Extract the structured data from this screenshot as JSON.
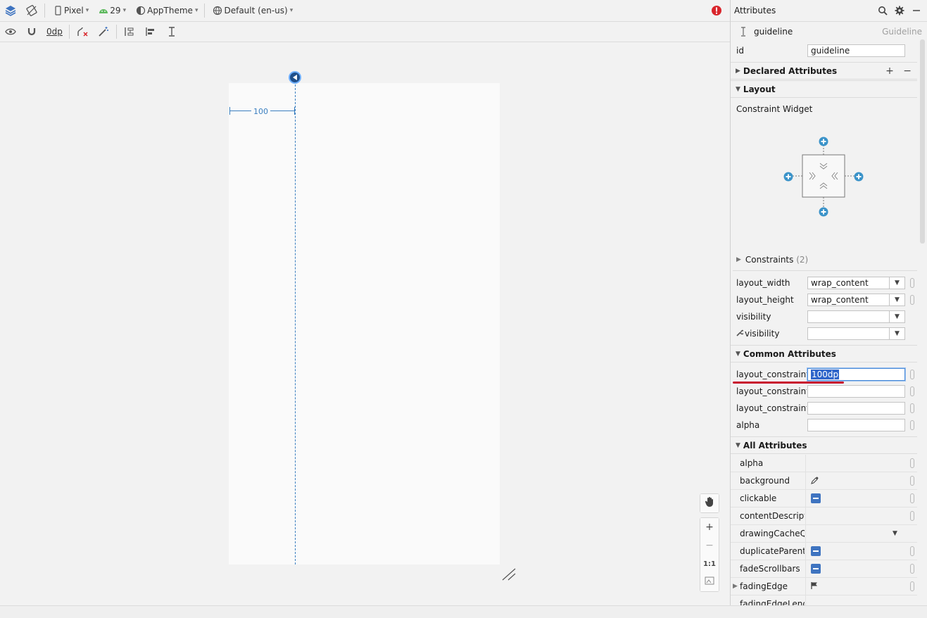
{
  "toolbar": {
    "device": "Pixel",
    "api": "29",
    "theme": "AppTheme",
    "locale": "Default (en-us)",
    "default_margin": "0dp"
  },
  "canvas": {
    "guide_dimension": "100"
  },
  "zoom": {
    "zoom_in": "+",
    "zoom_out": "−",
    "actual": "1:1"
  },
  "panel": {
    "title": "Attributes",
    "component_name": "guideline",
    "component_type": "Guideline",
    "id_label": "id",
    "id_value": "guideline",
    "declared_section": "Declared Attributes",
    "layout_section": "Layout",
    "constraint_widget_label": "Constraint Widget",
    "constraints_label": "Constraints",
    "constraints_count": "(2)",
    "layout_rows": [
      {
        "label": "layout_width",
        "value": "wrap_content"
      },
      {
        "label": "layout_height",
        "value": "wrap_content"
      },
      {
        "label": "visibility",
        "value": ""
      },
      {
        "label": "visibility",
        "value": ""
      }
    ],
    "common_section": "Common Attributes",
    "common_rows": [
      {
        "label": "layout_constraint...",
        "value": "100dp"
      },
      {
        "label": "layout_constraint...",
        "value": ""
      },
      {
        "label": "layout_constraint...",
        "value": ""
      },
      {
        "label": "alpha",
        "value": ""
      }
    ],
    "all_section": "All Attributes",
    "all_rows": [
      {
        "label": "alpha"
      },
      {
        "label": "background"
      },
      {
        "label": "clickable"
      },
      {
        "label": "contentDescripti..."
      },
      {
        "label": "drawingCacheQ..."
      },
      {
        "label": "duplicateParentS..."
      },
      {
        "label": "fadeScrollbars"
      },
      {
        "label": "fadingEdge"
      },
      {
        "label": "fadingEdgeLeng..."
      }
    ]
  },
  "colors": {
    "accent": "#3b7fc0",
    "error": "#d9262c",
    "highlight_underline": "#c8102e"
  }
}
